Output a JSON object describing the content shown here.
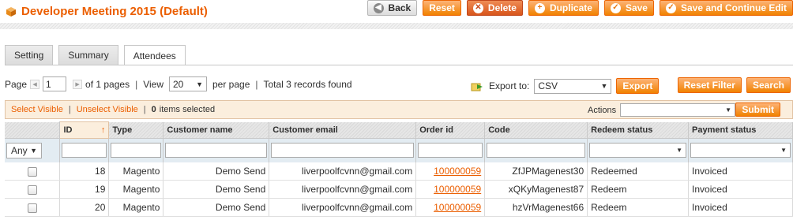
{
  "header": {
    "title": "Developer Meeting 2015 (Default)",
    "buttons": {
      "back": "Back",
      "reset": "Reset",
      "delete": "Delete",
      "duplicate": "Duplicate",
      "save": "Save",
      "save_continue": "Save and Continue Edit"
    }
  },
  "tabs": [
    {
      "label": "Setting"
    },
    {
      "label": "Summary"
    },
    {
      "label": "Attendees"
    }
  ],
  "pager": {
    "page_label": "Page",
    "page_value": "1",
    "of_pages": "of 1 pages",
    "view_label": "View",
    "per_page_value": "20",
    "per_page_label": "per page",
    "total": "Total 3 records found"
  },
  "export": {
    "label": "Export to:",
    "format": "CSV",
    "button": "Export"
  },
  "grid_buttons": {
    "reset_filter": "Reset Filter",
    "search": "Search"
  },
  "massaction": {
    "select_visible": "Select Visible",
    "unselect_visible": "Unselect Visible",
    "count": "0",
    "selected_label": "items selected",
    "actions_label": "Actions",
    "submit": "Submit"
  },
  "columns": [
    "ID",
    "Type",
    "Customer name",
    "Customer email",
    "Order id",
    "Code",
    "Redeem status",
    "Payment status"
  ],
  "filter": {
    "any": "Any"
  },
  "rows": [
    {
      "id": "18",
      "type": "Magento",
      "name": "Demo Send",
      "email": "liverpoolfcvnn@gmail.com",
      "order": "100000059",
      "code": "ZfJPMagenest30",
      "redeem": "Redeemed",
      "payment": "Invoiced"
    },
    {
      "id": "19",
      "type": "Magento",
      "name": "Demo Send",
      "email": "liverpoolfcvnn@gmail.com",
      "order": "100000059",
      "code": "xQKyMagenest87",
      "redeem": "Redeem",
      "payment": "Invoiced"
    },
    {
      "id": "20",
      "type": "Magento",
      "name": "Demo Send",
      "email": "liverpoolfcvnn@gmail.com",
      "order": "100000059",
      "code": "hzVrMagenest66",
      "redeem": "Redeem",
      "payment": "Invoiced"
    }
  ]
}
